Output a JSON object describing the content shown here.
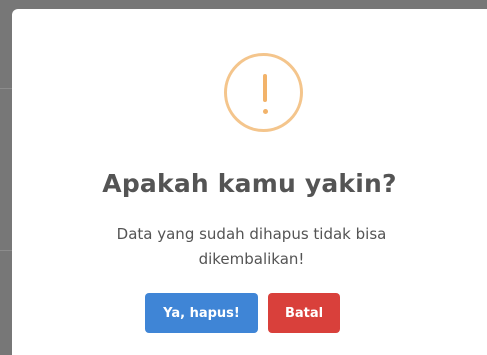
{
  "dialog": {
    "icon": "exclamation-warning-icon",
    "title": "Apakah kamu yakin?",
    "message": "Data yang sudah dihapus tidak bisa dikembalikan!",
    "confirm_label": "Ya, hapus!",
    "cancel_label": "Batal"
  },
  "colors": {
    "warning": "#f8bb86",
    "confirm": "#3f85d6",
    "cancel": "#d9403b",
    "text": "#545454"
  }
}
